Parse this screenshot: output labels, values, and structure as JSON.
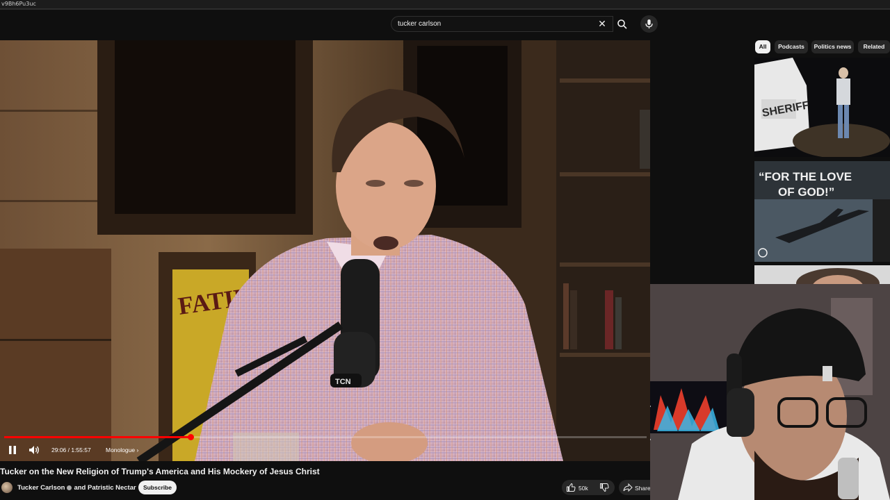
{
  "browser": {
    "url_fragment": "v9Bh6Pu3uc"
  },
  "masthead": {
    "search": {
      "query": "tucker carlson"
    },
    "icons": [
      "clear-icon",
      "search-icon",
      "mic-icon"
    ]
  },
  "player": {
    "time": "29:06 / 1:55:57",
    "chapter": "Monologue",
    "progress_fraction": 0.29,
    "overlay_text": {
      "poster": "FATIM",
      "mic_logo": "TCN"
    }
  },
  "video": {
    "title": "Tucker on the New Religion of Trump's America and His Mockery of Jesus Christ",
    "channel": "Tucker Carlson",
    "collab": "and Patristic Nectar",
    "subscribe_label": "Subscribe",
    "like_count": "50k",
    "share_label": "Share"
  },
  "sidebar": {
    "chips": [
      {
        "label": "All",
        "active": true
      },
      {
        "label": "Podcasts",
        "active": false
      },
      {
        "label": "Politics news",
        "active": false
      },
      {
        "label": "Related",
        "active": false
      }
    ],
    "thumbnails": [
      {
        "overlay_text": "SHERIFF"
      },
      {
        "overlay_text_line1": "“FOR THE LOVE",
        "overlay_text_line2": "OF GOD!”"
      },
      {
        "overlay_text": ""
      }
    ]
  },
  "colors": {
    "accent_red": "#ff0000",
    "background": "#0f0f0f",
    "pill": "#272727"
  }
}
